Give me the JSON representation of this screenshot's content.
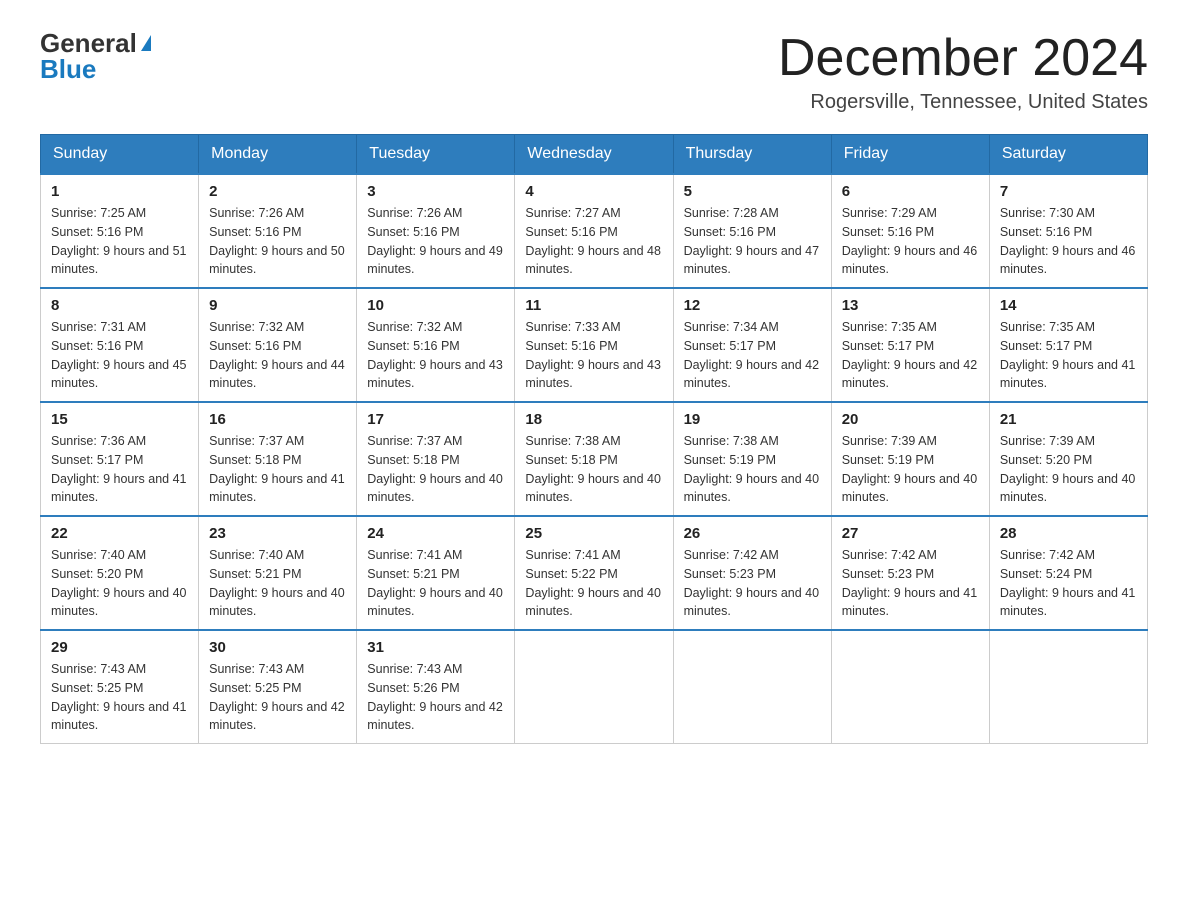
{
  "header": {
    "logo_general": "General",
    "logo_blue": "Blue",
    "month_title": "December 2024",
    "location": "Rogersville, Tennessee, United States"
  },
  "weekdays": [
    "Sunday",
    "Monday",
    "Tuesday",
    "Wednesday",
    "Thursday",
    "Friday",
    "Saturday"
  ],
  "weeks": [
    [
      {
        "day": "1",
        "sunrise": "7:25 AM",
        "sunset": "5:16 PM",
        "daylight": "9 hours and 51 minutes."
      },
      {
        "day": "2",
        "sunrise": "7:26 AM",
        "sunset": "5:16 PM",
        "daylight": "9 hours and 50 minutes."
      },
      {
        "day": "3",
        "sunrise": "7:26 AM",
        "sunset": "5:16 PM",
        "daylight": "9 hours and 49 minutes."
      },
      {
        "day": "4",
        "sunrise": "7:27 AM",
        "sunset": "5:16 PM",
        "daylight": "9 hours and 48 minutes."
      },
      {
        "day": "5",
        "sunrise": "7:28 AM",
        "sunset": "5:16 PM",
        "daylight": "9 hours and 47 minutes."
      },
      {
        "day": "6",
        "sunrise": "7:29 AM",
        "sunset": "5:16 PM",
        "daylight": "9 hours and 46 minutes."
      },
      {
        "day": "7",
        "sunrise": "7:30 AM",
        "sunset": "5:16 PM",
        "daylight": "9 hours and 46 minutes."
      }
    ],
    [
      {
        "day": "8",
        "sunrise": "7:31 AM",
        "sunset": "5:16 PM",
        "daylight": "9 hours and 45 minutes."
      },
      {
        "day": "9",
        "sunrise": "7:32 AM",
        "sunset": "5:16 PM",
        "daylight": "9 hours and 44 minutes."
      },
      {
        "day": "10",
        "sunrise": "7:32 AM",
        "sunset": "5:16 PM",
        "daylight": "9 hours and 43 minutes."
      },
      {
        "day": "11",
        "sunrise": "7:33 AM",
        "sunset": "5:16 PM",
        "daylight": "9 hours and 43 minutes."
      },
      {
        "day": "12",
        "sunrise": "7:34 AM",
        "sunset": "5:17 PM",
        "daylight": "9 hours and 42 minutes."
      },
      {
        "day": "13",
        "sunrise": "7:35 AM",
        "sunset": "5:17 PM",
        "daylight": "9 hours and 42 minutes."
      },
      {
        "day": "14",
        "sunrise": "7:35 AM",
        "sunset": "5:17 PM",
        "daylight": "9 hours and 41 minutes."
      }
    ],
    [
      {
        "day": "15",
        "sunrise": "7:36 AM",
        "sunset": "5:17 PM",
        "daylight": "9 hours and 41 minutes."
      },
      {
        "day": "16",
        "sunrise": "7:37 AM",
        "sunset": "5:18 PM",
        "daylight": "9 hours and 41 minutes."
      },
      {
        "day": "17",
        "sunrise": "7:37 AM",
        "sunset": "5:18 PM",
        "daylight": "9 hours and 40 minutes."
      },
      {
        "day": "18",
        "sunrise": "7:38 AM",
        "sunset": "5:18 PM",
        "daylight": "9 hours and 40 minutes."
      },
      {
        "day": "19",
        "sunrise": "7:38 AM",
        "sunset": "5:19 PM",
        "daylight": "9 hours and 40 minutes."
      },
      {
        "day": "20",
        "sunrise": "7:39 AM",
        "sunset": "5:19 PM",
        "daylight": "9 hours and 40 minutes."
      },
      {
        "day": "21",
        "sunrise": "7:39 AM",
        "sunset": "5:20 PM",
        "daylight": "9 hours and 40 minutes."
      }
    ],
    [
      {
        "day": "22",
        "sunrise": "7:40 AM",
        "sunset": "5:20 PM",
        "daylight": "9 hours and 40 minutes."
      },
      {
        "day": "23",
        "sunrise": "7:40 AM",
        "sunset": "5:21 PM",
        "daylight": "9 hours and 40 minutes."
      },
      {
        "day": "24",
        "sunrise": "7:41 AM",
        "sunset": "5:21 PM",
        "daylight": "9 hours and 40 minutes."
      },
      {
        "day": "25",
        "sunrise": "7:41 AM",
        "sunset": "5:22 PM",
        "daylight": "9 hours and 40 minutes."
      },
      {
        "day": "26",
        "sunrise": "7:42 AM",
        "sunset": "5:23 PM",
        "daylight": "9 hours and 40 minutes."
      },
      {
        "day": "27",
        "sunrise": "7:42 AM",
        "sunset": "5:23 PM",
        "daylight": "9 hours and 41 minutes."
      },
      {
        "day": "28",
        "sunrise": "7:42 AM",
        "sunset": "5:24 PM",
        "daylight": "9 hours and 41 minutes."
      }
    ],
    [
      {
        "day": "29",
        "sunrise": "7:43 AM",
        "sunset": "5:25 PM",
        "daylight": "9 hours and 41 minutes."
      },
      {
        "day": "30",
        "sunrise": "7:43 AM",
        "sunset": "5:25 PM",
        "daylight": "9 hours and 42 minutes."
      },
      {
        "day": "31",
        "sunrise": "7:43 AM",
        "sunset": "5:26 PM",
        "daylight": "9 hours and 42 minutes."
      },
      null,
      null,
      null,
      null
    ]
  ]
}
